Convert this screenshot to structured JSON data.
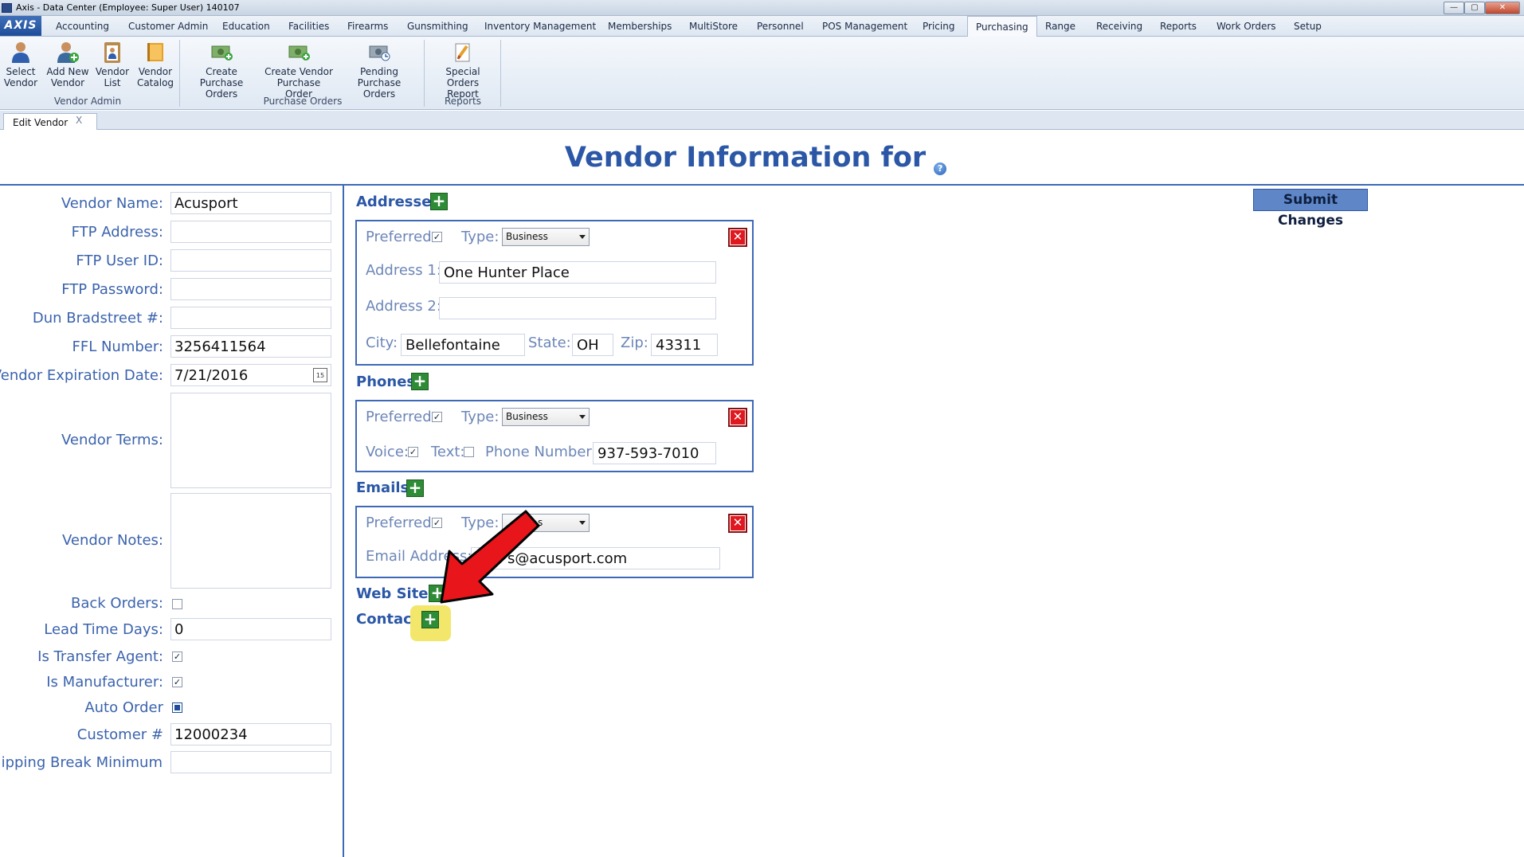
{
  "window": {
    "title": "Axis - Data Center  (Employee: Super User) 140107",
    "min": "—",
    "max": "▢",
    "close": "✕"
  },
  "menu": {
    "logo": "AXIS",
    "tabs": [
      "Accounting",
      "Customer Admin",
      "Education",
      "Facilities",
      "Firearms",
      "Gunsmithing",
      "Inventory Management",
      "Memberships",
      "MultiStore",
      "Personnel",
      "POS Management",
      "Pricing",
      "Purchasing",
      "Range",
      "Receiving",
      "Reports",
      "Work Orders",
      "Setup"
    ],
    "active": "Purchasing"
  },
  "ribbon": {
    "buttons": [
      {
        "label1": "Select",
        "label2": "Vendor",
        "icon": "person-icon"
      },
      {
        "label1": "Add New",
        "label2": "Vendor",
        "icon": "person-add-icon"
      },
      {
        "label1": "Vendor",
        "label2": "List",
        "icon": "clipboard-icon"
      },
      {
        "label1": "Vendor",
        "label2": "Catalog",
        "icon": "book-icon"
      },
      {
        "label1": "Create Purchase",
        "label2": "Orders",
        "icon": "money-add-icon"
      },
      {
        "label1": "Create Vendor",
        "label2": "Purchase Order",
        "icon": "money-add-icon"
      },
      {
        "label1": "Pending Purchase",
        "label2": "Orders",
        "icon": "money-clock-icon"
      },
      {
        "label1": "Special Orders",
        "label2": "Report",
        "icon": "report-icon"
      }
    ],
    "groups": [
      "Vendor Admin",
      "Purchase Orders",
      "Reports"
    ]
  },
  "doc_tab": {
    "label": "Edit Vendor",
    "close": "X"
  },
  "page": {
    "title": "Vendor Information for",
    "help": "?",
    "submit": "Submit Changes"
  },
  "vendor": {
    "labels": {
      "name": "Vendor Name:",
      "ftp_address": "FTP Address:",
      "ftp_user": "FTP User ID:",
      "ftp_password": "FTP Password:",
      "dun": "Dun Bradstreet #:",
      "ffl": "FFL Number:",
      "expiration": "Vendor Expiration Date:",
      "terms": "Vendor Terms:",
      "notes": "Vendor Notes:",
      "back_orders": "Back Orders:",
      "lead_time": "Lead Time Days:",
      "transfer_agent": "Is Transfer Agent:",
      "manufacturer": "Is Manufacturer:",
      "auto_order": "Auto Order",
      "customer": "Customer #",
      "shipping_break": "Shipping Break Minimum"
    },
    "values": {
      "name": "Acusport",
      "ftp_address": "",
      "ftp_user": "",
      "ftp_password": "",
      "dun": "",
      "ffl": "3256411564",
      "expiration": "7/21/2016",
      "calendar_day": "15",
      "lead_time": "0",
      "customer": "12000234",
      "shipping_break": "",
      "back_orders": false,
      "transfer_agent": true,
      "manufacturer": true,
      "auto_order": "indeterminate"
    }
  },
  "addresses": {
    "title": "Addresses",
    "preferred_label": "Preferred:",
    "type_label": "Type:",
    "type_value": "Business",
    "address1_label": "Address 1:",
    "address1": "One Hunter Place",
    "address2_label": "Address 2:",
    "address2": "",
    "city_label": "City:",
    "city": "Bellefontaine",
    "state_label": "State:",
    "state": "OH",
    "zip_label": "Zip:",
    "zip": "43311"
  },
  "phones": {
    "title": "Phones",
    "preferred_label": "Preferred:",
    "type_label": "Type:",
    "type_value": "Business",
    "voice_label": "Voice:",
    "text_label": "Text:",
    "number_label": "Phone Number:",
    "number": "937-593-7010"
  },
  "emails": {
    "title": "Emails",
    "preferred_label": "Preferred:",
    "type_label": "Type:",
    "type_value": "s",
    "address_label": "Email Address:",
    "address": "s@acusport.com"
  },
  "web_sites": {
    "title": "Web Sites"
  },
  "contacts": {
    "title": "Contacts"
  },
  "glyphs": {
    "plus": "+",
    "delete": "✕",
    "check": "✓"
  },
  "annotation": {
    "highlight_color": "#f2e76b",
    "arrow_color": "#e8151b"
  }
}
